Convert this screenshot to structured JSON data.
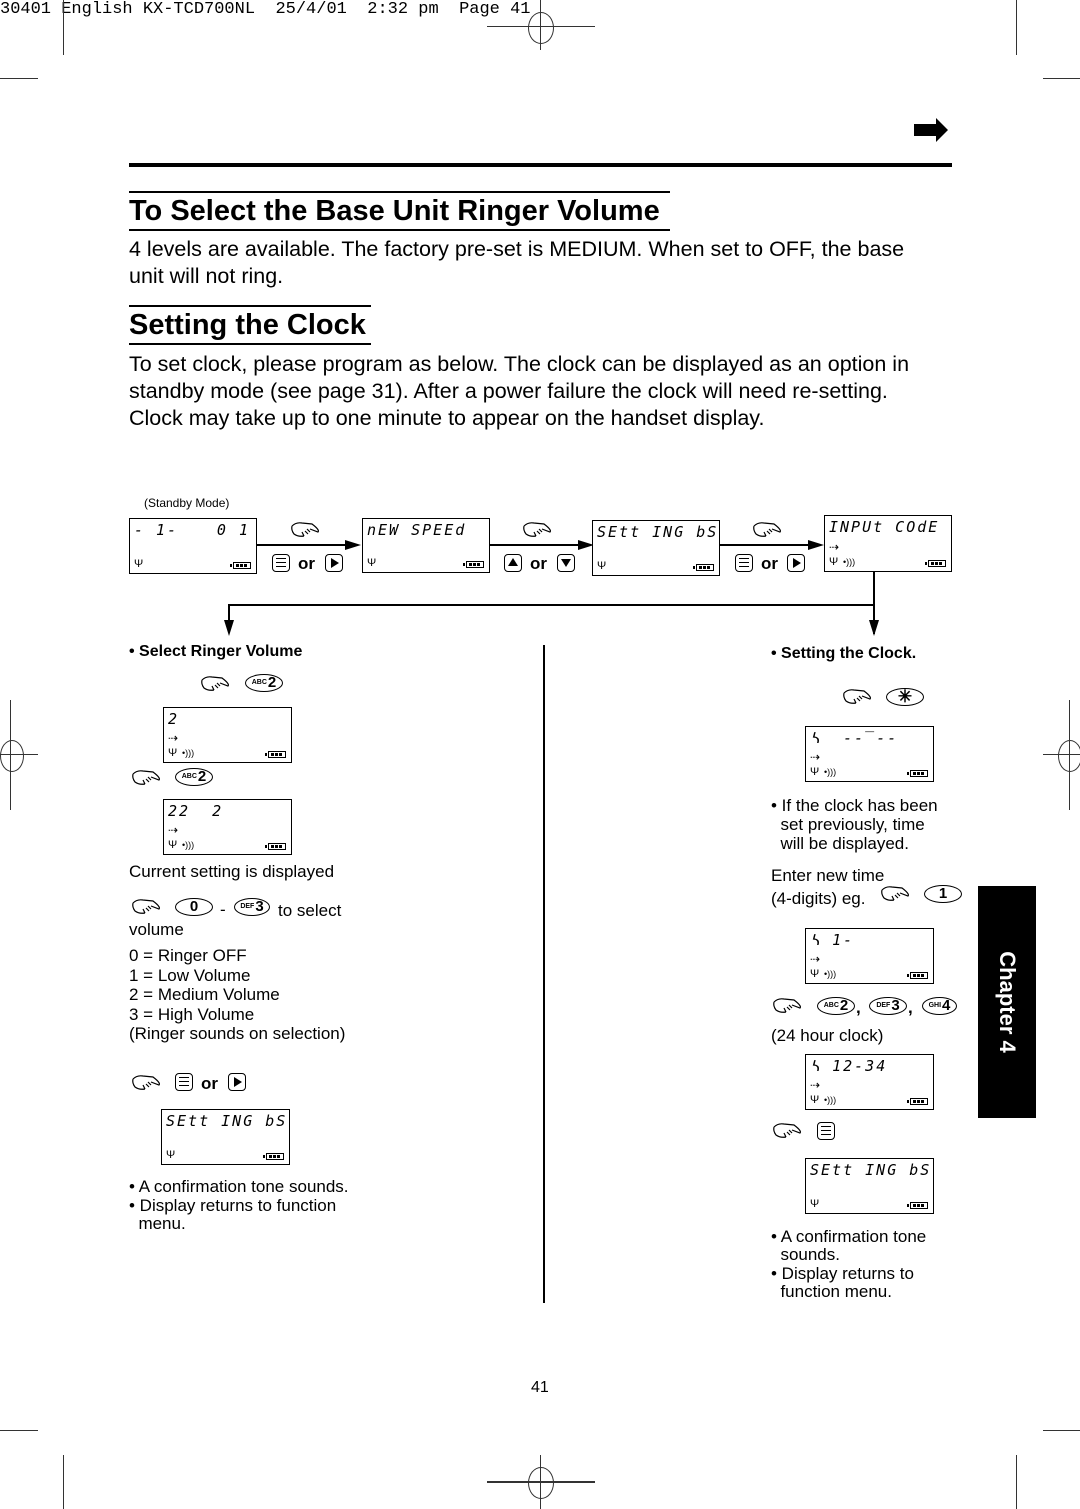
{
  "print_header": "30401 English KX-TCD700NL  25/4/01  2:32 pm  Page 41",
  "section1": {
    "title": "To Select the Base Unit Ringer Volume",
    "body": "4 levels are available. The factory pre-set is MEDIUM. When set to OFF, the base unit will not ring."
  },
  "section2": {
    "title": "Setting the Clock",
    "body": "To set clock, please program as below. The clock can be displayed as an option in standby mode (see page 31). After a power failure the clock will need re-setting. Clock may take up to one minute to appear on the handset display."
  },
  "flow": {
    "standby_label": "(Standby Mode)",
    "or": "or",
    "displays": [
      {
        "left": "- 1-",
        "right": "0 1"
      },
      {
        "left": "nEW SPEEd"
      },
      {
        "left": "SEtt ING bS"
      },
      {
        "left": "INPUt COdE"
      }
    ]
  },
  "left_column": {
    "heading": "• Select Ringer Volume",
    "key_abc2": {
      "letters": "ABC",
      "digit": "2"
    },
    "display1": "2",
    "display2": "22  2",
    "current_setting": "Current setting is displayed",
    "key_0": "0",
    "dash": "-",
    "key_def3": {
      "letters": "DEF",
      "digit": "3"
    },
    "to_select": "to select",
    "volume": "volume",
    "levels": [
      "0 = Ringer OFF",
      "1 = Low Volume",
      "2 = Medium Volume",
      "3 = High Volume",
      "(Ringer sounds on selection)"
    ],
    "or": "or",
    "display3": "SEtt ING bS",
    "notes": [
      "• A confirmation tone sounds.",
      "• Display returns to function",
      "  menu."
    ]
  },
  "right_column": {
    "heading": "• Setting the Clock.",
    "key_star": "✳",
    "display1": "ᓴ  --‾--",
    "note1": [
      "• If the clock has been",
      "  set previously, time",
      "  will be displayed."
    ],
    "enter_time": "Enter new time",
    "digits_eg": "(4-digits) eg.",
    "key_1": "1",
    "display2": "ᓴ 1-",
    "keys": [
      {
        "letters": "ABC",
        "digit": "2"
      },
      {
        "letters": "DEF",
        "digit": "3"
      },
      {
        "letters": "GHI",
        "digit": "4"
      }
    ],
    "comma": ",",
    "hour_clock": "(24 hour clock)",
    "display3": "ᓴ 12-34",
    "display4": "SEtt ING bS",
    "notes": [
      "• A confirmation tone",
      "  sounds.",
      "• Display returns to",
      "  function menu."
    ]
  },
  "chapter_tab": "Chapter 4",
  "page_number": "41"
}
